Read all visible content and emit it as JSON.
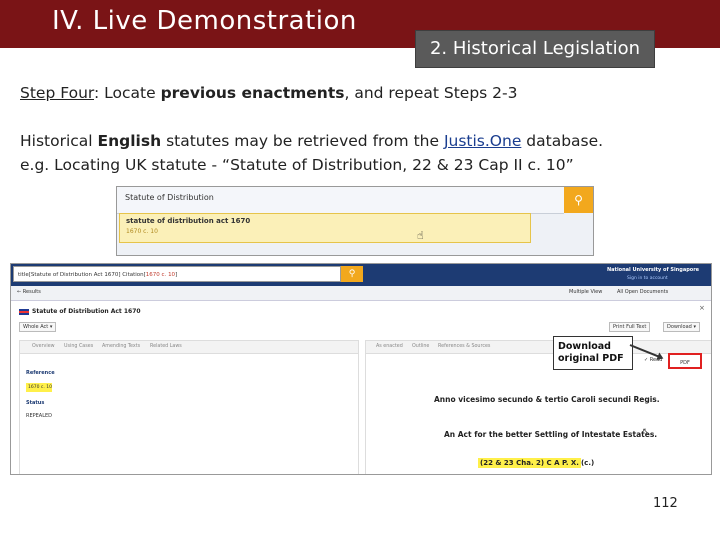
{
  "header": {
    "title": "IV. Live Demonstration",
    "section": "2. Historical Legislation",
    "band_color": "#7a1416"
  },
  "step": {
    "label": "Step Four",
    "colon": ": Locate ",
    "bold": "previous enactments",
    "rest": ", and repeat Steps 2-3"
  },
  "para1": {
    "pre": "Historical ",
    "bold": "English",
    "mid": " statutes may be retrieved from the ",
    "link": "Justis.One",
    "post": " database."
  },
  "para2": "e.g. Locating UK statute - “Statute of Distribution, 22 & 23 Cap II c. 10”",
  "shot1": {
    "search_value": "Statute of Distribution",
    "suggestion_title": "statute of distribution act 1670",
    "suggestion_sub": "1670 c. 10"
  },
  "shot2": {
    "search_pre": "title[Statute of Distribution Act 1670] Citation[",
    "search_hl": "1670 c. 10",
    "search_post": "]",
    "institution": "National University of Singapore",
    "sign_in": "Sign in to account",
    "back": "← Results",
    "multiple_view": "Multiple View",
    "all_open": "All Open Documents",
    "doc_title": "Statute of Distribution Act 1670",
    "close": "×",
    "whole_act": "Whole Act ▾",
    "print": "Print Full Text",
    "download": "Download ▾",
    "left_tabs": [
      "Overview",
      "Using Cases",
      "Amending Texts",
      "Related Laws"
    ],
    "reference_label": "Reference",
    "reference_value": "1670 c. 10",
    "status_label": "Status",
    "status_value": "REPEALED",
    "right_tabs": [
      "As enacted",
      "Outline",
      "References & Sources"
    ],
    "read": "✓ Read",
    "pdf": "PDF",
    "text1": "Anno vicesimo secundo & tertio Caroli secundi Regis.",
    "text2": "An Act for the better Settling of Intestate Estates.",
    "text3_hl": "(22 & 23 Cha. 2) C A P. X.",
    "text3_post": "(c.)"
  },
  "callout": {
    "line1": "Download",
    "line2": "original PDF"
  },
  "page_number": "112"
}
